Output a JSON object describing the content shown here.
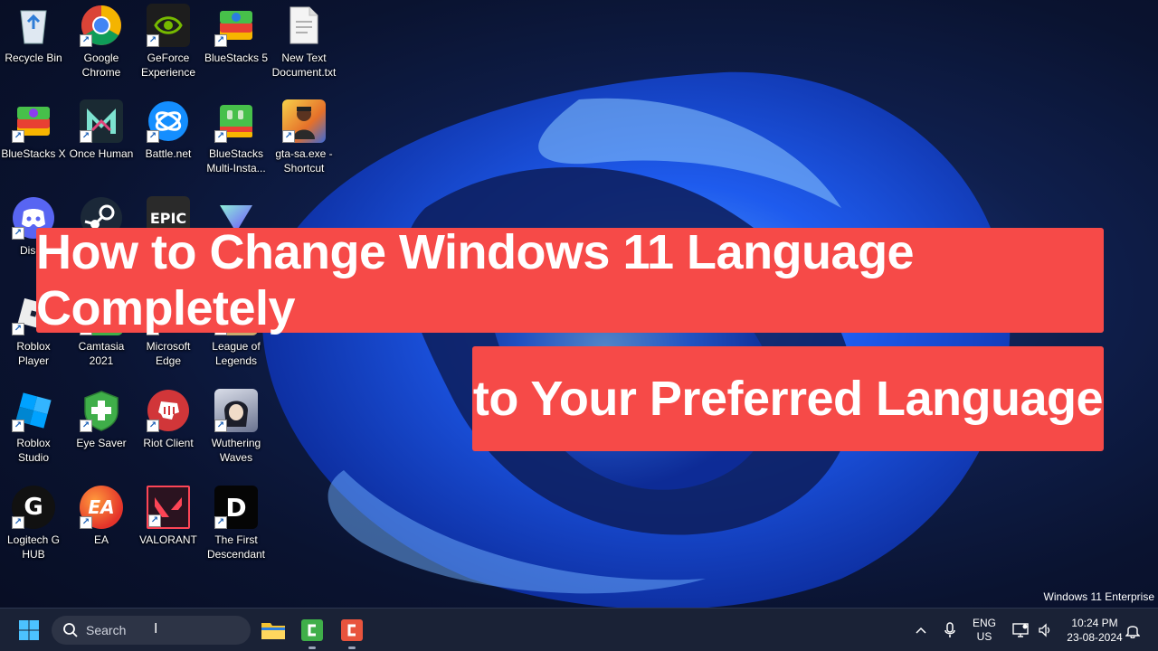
{
  "desktop": {
    "icons": [
      {
        "label": "Recycle Bin",
        "icon": "recycle-bin-icon"
      },
      {
        "label": "Google Chrome",
        "icon": "chrome-icon"
      },
      {
        "label": "GeForce Experience",
        "icon": "geforce-icon"
      },
      {
        "label": "BlueStacks 5",
        "icon": "bluestacks-icon"
      },
      {
        "label": "New Text Document.txt",
        "icon": "text-file-icon"
      },
      {
        "label": "BlueStacks X",
        "icon": "bluestacks-x-icon"
      },
      {
        "label": "Once Human",
        "icon": "once-human-icon"
      },
      {
        "label": "Battle.net",
        "icon": "battlenet-icon"
      },
      {
        "label": "BlueStacks Multi-Insta...",
        "icon": "bluestacks-multi-icon"
      },
      {
        "label": "gta-sa.exe - Shortcut",
        "icon": "gta-icon"
      },
      {
        "label": "Disco",
        "icon": "discord-icon"
      },
      {
        "label": "",
        "icon": "steam-icon"
      },
      {
        "label": "",
        "icon": "epic-games-icon"
      },
      {
        "label": "",
        "icon": "proton-vpn-icon"
      },
      {
        "label": "Roblox Player",
        "icon": "roblox-icon"
      },
      {
        "label": "Camtasia 2021",
        "icon": "camtasia-icon"
      },
      {
        "label": "Microsoft Edge",
        "icon": "edge-icon"
      },
      {
        "label": "League of Legends",
        "icon": "league-icon"
      },
      {
        "label": "Roblox Studio",
        "icon": "roblox-studio-icon"
      },
      {
        "label": "Eye Saver",
        "icon": "eye-saver-icon"
      },
      {
        "label": "Riot Client",
        "icon": "riot-client-icon"
      },
      {
        "label": "Wuthering Waves",
        "icon": "wuthering-waves-icon"
      },
      {
        "label": "Logitech G HUB",
        "icon": "logitech-icon"
      },
      {
        "label": "EA",
        "icon": "ea-icon"
      },
      {
        "label": "VALORANT",
        "icon": "valorant-icon"
      },
      {
        "label": "The First Descendant",
        "icon": "first-descendant-icon"
      }
    ],
    "icon_glyphs": {
      "epic": "EPIC",
      "ea": "EA",
      "logitech": "G",
      "descendant": "D"
    },
    "edition_text": "Windows 11 Enterprise"
  },
  "banner": {
    "line1": "How to Change Windows 11 Language Completely",
    "line2": "to Your Preferred Language",
    "color": "#f64a48"
  },
  "taskbar": {
    "search_placeholder": "Search",
    "apps": [
      "file-explorer-icon",
      "camtasia-icon",
      "camtasia-recorder-icon"
    ],
    "tray": {
      "lang_line1": "ENG",
      "lang_line2": "US",
      "time": "10:24 PM",
      "date": "23-08-2024"
    }
  }
}
